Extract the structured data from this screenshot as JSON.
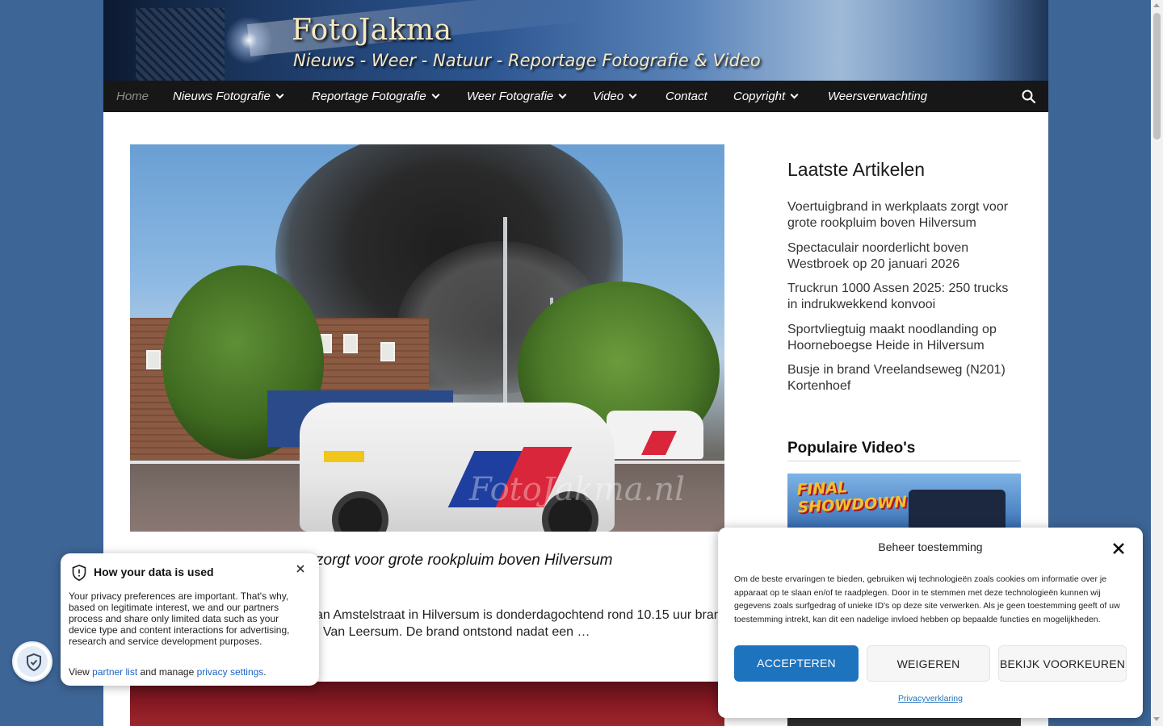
{
  "header": {
    "site_title": "FotoJakma",
    "tagline": "Nieuws - Weer - Natuur - Reportage Fotografie & Video"
  },
  "nav": {
    "items": [
      {
        "label": "Home",
        "has_dropdown": false,
        "active": true
      },
      {
        "label": "Nieuws Fotografie",
        "has_dropdown": true
      },
      {
        "label": "Reportage Fotografie",
        "has_dropdown": true
      },
      {
        "label": "Weer Fotografie",
        "has_dropdown": true
      },
      {
        "label": "Video",
        "has_dropdown": true
      },
      {
        "label": "Contact",
        "has_dropdown": false
      },
      {
        "label": "Copyright",
        "has_dropdown": true
      },
      {
        "label": "Weersverwachting",
        "has_dropdown": false
      }
    ],
    "search_icon": "search-icon"
  },
  "main": {
    "hero_watermark": "FotoJakma.nl",
    "article_title_visible": "zorgt voor grote rookpluim boven Hilversum",
    "article_excerpt_line1": "an Amstelstraat in Hilversum is donderdagochtend rond 10.15 uur bran",
    "article_excerpt_line2": "el Van Leersum. De brand ontstond nadat een …"
  },
  "sidebar": {
    "latest_heading": "Laatste Artikelen",
    "latest": [
      "Voertuigbrand in werkplaats zorgt voor grote rookpluim boven Hilversum",
      "Spectaculair noorderlicht boven Westbroek op 20 januari 2026",
      "Truckrun 1000 Assen 2025: 250 trucks in indrukwekkend konvooi",
      "Sportvliegtuig maakt noodlanding op Hoorneboegse Heide in Hilversum",
      "Busje in brand Vreelandseweg (N201) Kortenhoef"
    ],
    "videos_heading": "Populaire Video's",
    "video_thumb_text": "FINAL SHOWDOWN"
  },
  "privacy_popup": {
    "title": "How your data is used",
    "body": "Your privacy preferences are important. That's why, based on legitimate interest, we and our partners process and share only limited data such as your device type and content interactions for advertising, research and service development purposes.",
    "links_prefix": "View",
    "partner_link": "partner list",
    "links_middle": "and manage",
    "settings_link": "privacy settings",
    "links_suffix": "."
  },
  "consent": {
    "title": "Beheer toestemming",
    "text": "Om de beste ervaringen te bieden, gebruiken wij technologieën zoals cookies om informatie over je apparaat op te slaan en/of te raadplegen. Door in te stemmen met deze technologieën kunnen wij gegevens zoals surfgedrag of unieke ID's op deze site verwerken. Als je geen toestemming geeft of uw toestemming intrekt, kan dit een nadelige invloed hebben op bepaalde functies en mogelijkheden.",
    "accept": "ACCEPTEREN",
    "deny": "WEIGEREN",
    "preferences": "BEKIJK VOORKEUREN",
    "privacy_link": "Privacyverklaring"
  },
  "colors": {
    "page_bg": "#3d6596",
    "nav_bg": "#171717",
    "accent_blue": "#1e73be"
  }
}
